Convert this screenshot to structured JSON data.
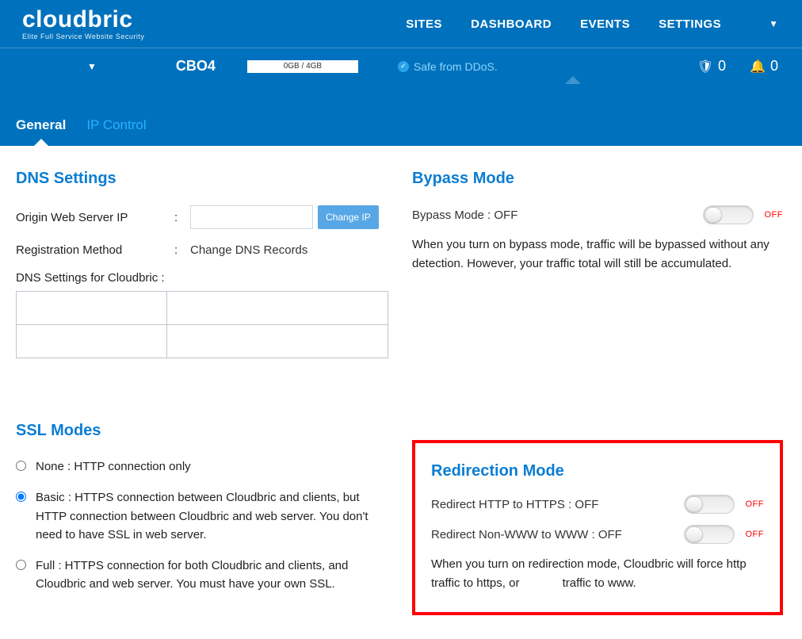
{
  "brand": {
    "name": "cloudbric",
    "tagline": "Elite Full Service Website Security"
  },
  "nav": [
    "SITES",
    "DASHBOARD",
    "EVENTS",
    "SETTINGS"
  ],
  "status": {
    "site_code": "CBO4",
    "usage": "0GB / 4GB",
    "ddos": "Safe from DDoS.",
    "shield_count": "0",
    "bell_count": "0"
  },
  "tabs": {
    "general": "General",
    "ip_control": "IP Control"
  },
  "dns": {
    "heading": "DNS Settings",
    "origin_label": "Origin Web Server IP",
    "change_btn": "Change IP",
    "reg_label": "Registration Method",
    "reg_value": "Change DNS Records",
    "list_label": "DNS Settings for Cloudbric :",
    "cells": {
      "r1c1": "",
      "r1c2": "",
      "r2c1": "",
      "r2c2": ""
    }
  },
  "ssl": {
    "heading": "SSL Modes",
    "none": "None : HTTP connection only",
    "basic": "Basic : HTTPS connection between Cloudbric and clients, but HTTP connection between Cloudbric and web server. You don't need to have SSL in web server.",
    "full": "Full : HTTPS connection for both Cloudbric and clients, and Cloudbric and web server. You must have your own SSL."
  },
  "bypass": {
    "heading": "Bypass Mode",
    "label": "Bypass Mode : OFF",
    "off": "OFF",
    "desc": "When you turn on bypass mode, traffic will be bypassed without any detection. However, your traffic total will still be accumulated."
  },
  "redir": {
    "heading": "Redirection Mode",
    "https_label": "Redirect HTTP to HTTPS : OFF",
    "www_label": "Redirect Non-WWW to WWW : OFF",
    "off": "OFF",
    "desc": "When you turn on redirection mode, Cloudbric will force http traffic to https, or             traffic to www."
  }
}
